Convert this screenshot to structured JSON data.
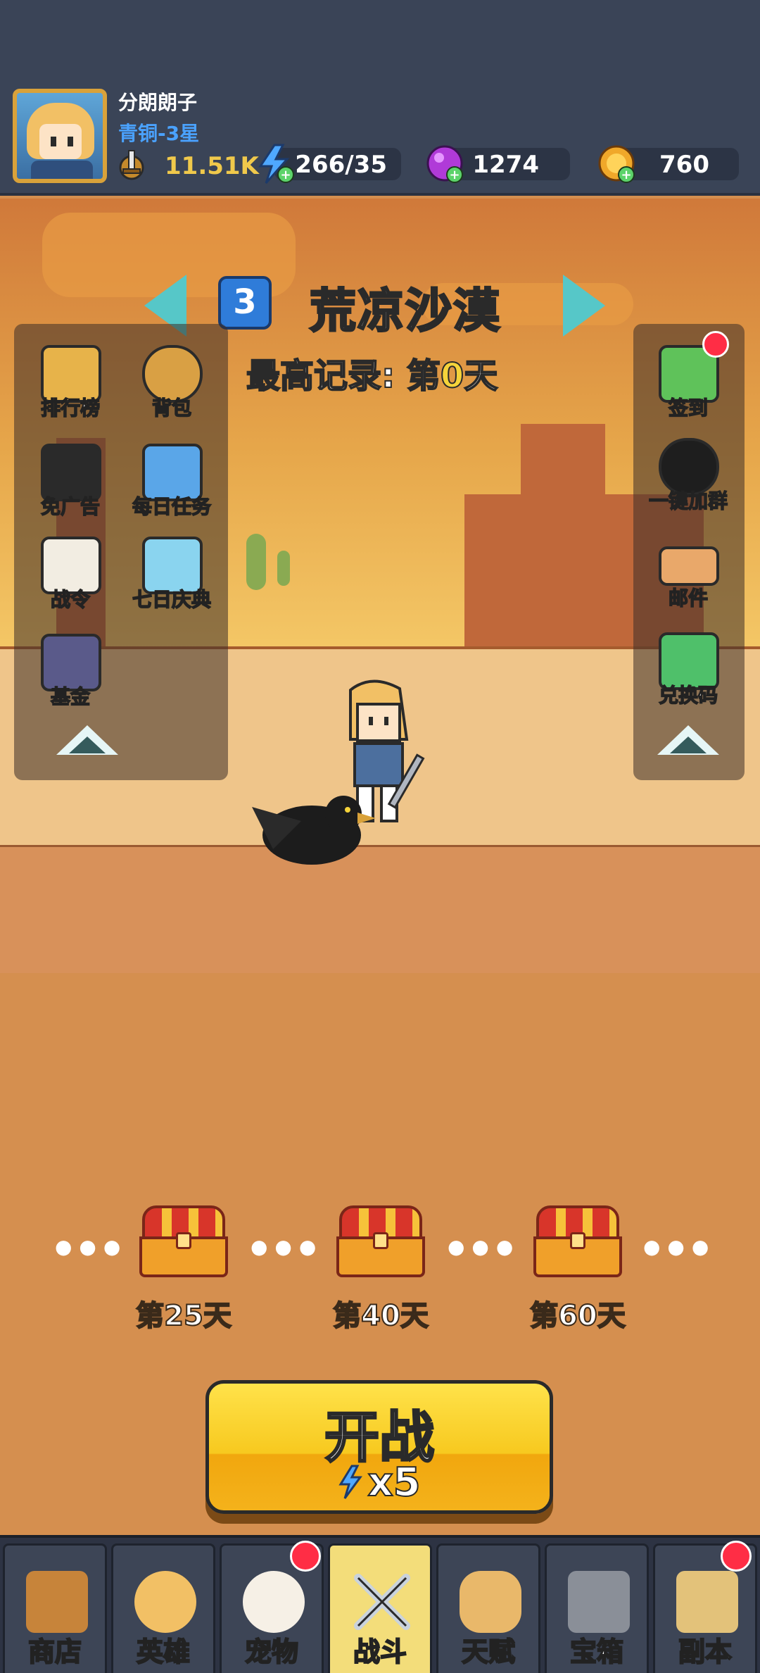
{
  "player": {
    "name": "分朗朗子",
    "rank": "青铜-3星",
    "power": "11.51K"
  },
  "resources": {
    "energy": "266/35",
    "gems": "1274",
    "gold": "760"
  },
  "stage": {
    "number": "3",
    "name": "荒凉沙漠",
    "record_prefix": "最高记录: 第",
    "record_day": "0",
    "record_suffix": "天"
  },
  "left_panel": [
    {
      "label": "排行榜",
      "icon": "leaderboard-icon"
    },
    {
      "label": "背包",
      "icon": "backpack-icon"
    },
    {
      "label": "免广告",
      "icon": "no-ads-icon"
    },
    {
      "label": "每日任务",
      "icon": "daily-task-icon"
    },
    {
      "label": "战令",
      "icon": "battle-pass-icon"
    },
    {
      "label": "七日庆典",
      "icon": "seven-day-gift-icon"
    },
    {
      "label": "基金",
      "icon": "fund-icon"
    }
  ],
  "right_panel": [
    {
      "label": "签到",
      "icon": "checkin-calendar-icon"
    },
    {
      "label": "一键加群",
      "icon": "qq-penguin-icon"
    },
    {
      "label": "邮件",
      "icon": "mail-scroll-icon"
    },
    {
      "label": "兑换码",
      "icon": "redeem-code-icon"
    }
  ],
  "milestones": [
    {
      "label": "第25天"
    },
    {
      "label": "第40天"
    },
    {
      "label": "第60天"
    }
  ],
  "battle": {
    "title": "开战",
    "cost": "x5"
  },
  "nav": [
    {
      "label": "商店",
      "icon": "shop-stall-icon"
    },
    {
      "label": "英雄",
      "icon": "hero-icon"
    },
    {
      "label": "宠物",
      "icon": "pet-rabbit-icon"
    },
    {
      "label": "战斗",
      "icon": "crossed-swords-icon"
    },
    {
      "label": "天赋",
      "icon": "winged-fist-icon"
    },
    {
      "label": "宝箱",
      "icon": "treasure-chest-icon"
    },
    {
      "label": "副本",
      "icon": "map-scroll-icon"
    }
  ],
  "colors": {
    "topbar": "#3a4457",
    "accent_gold": "#f0c94b",
    "rank_blue": "#4aa2ff",
    "notification_red": "#ff2d45"
  }
}
